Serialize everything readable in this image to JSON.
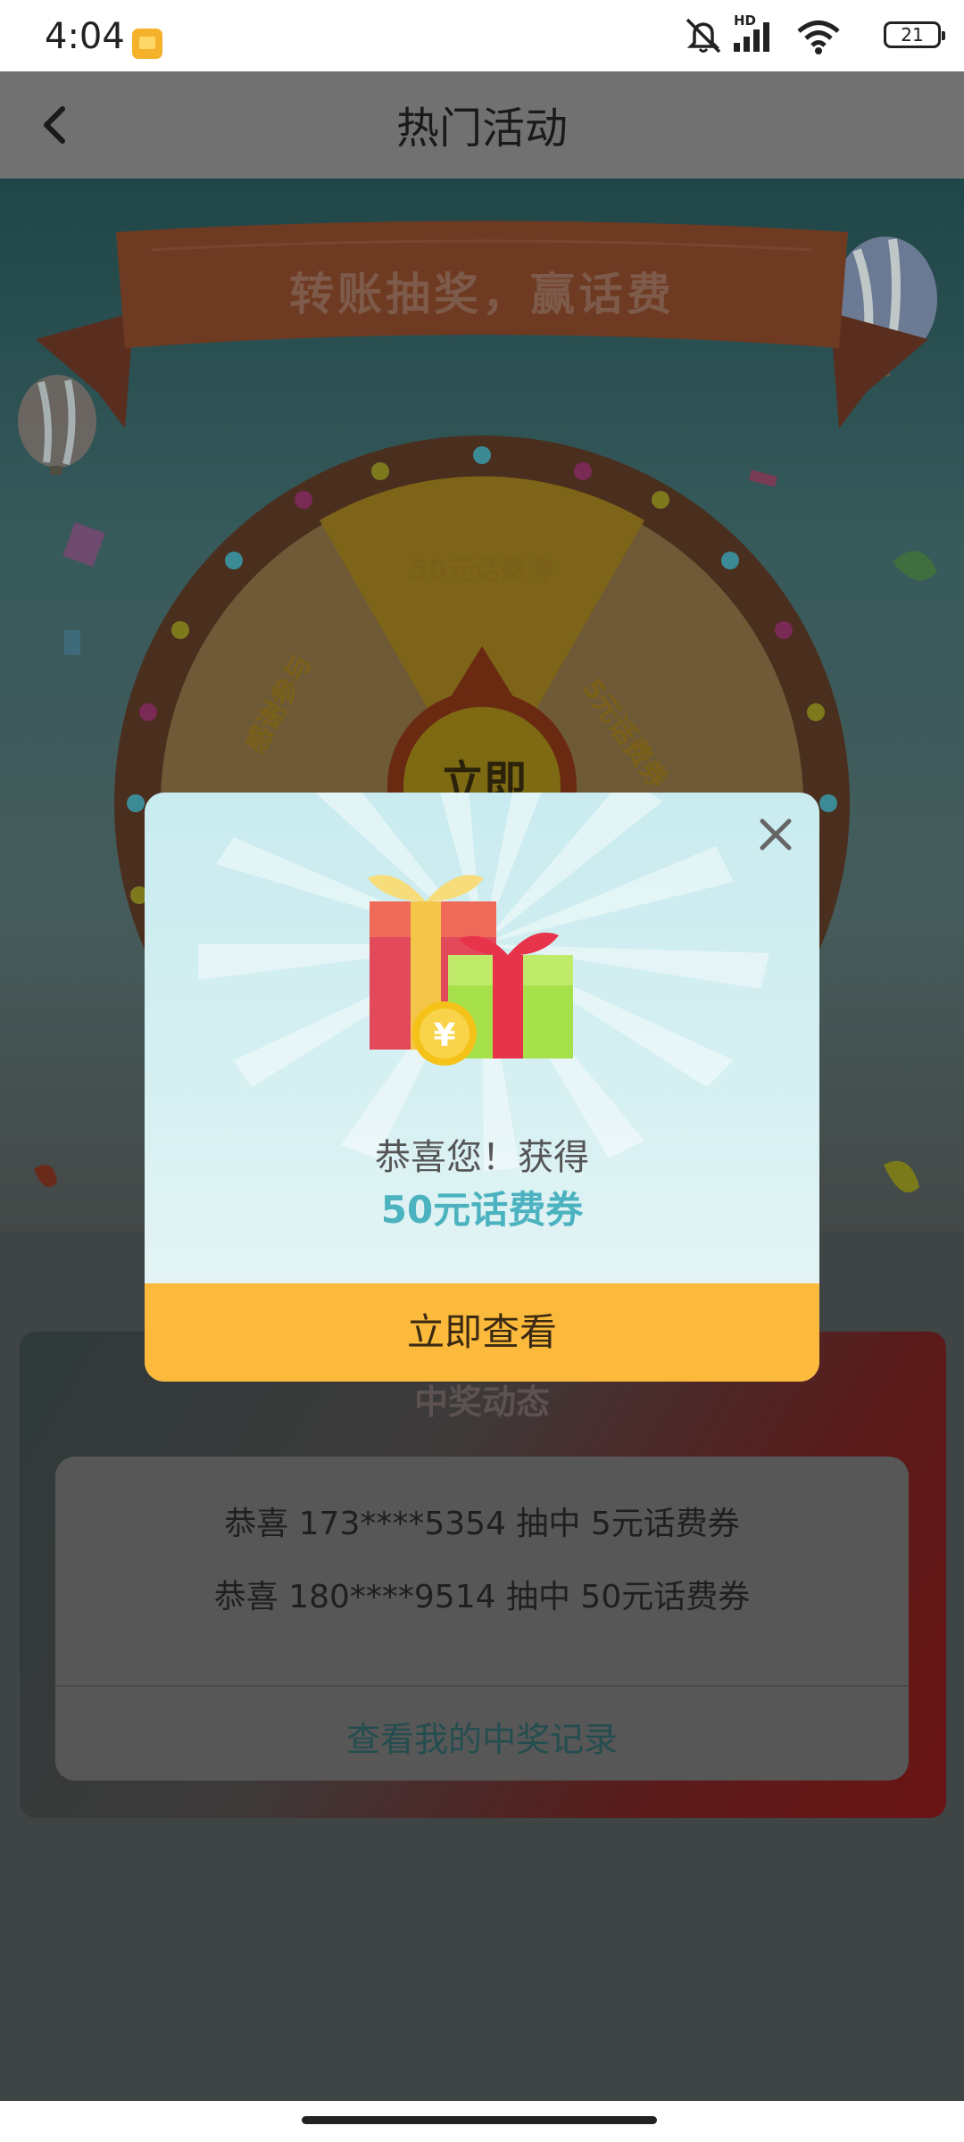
{
  "status_bar": {
    "time": "4:04",
    "battery": "21",
    "hd": "HD",
    "icons": [
      "notification-app-icon",
      "mute-icon",
      "signal-icon",
      "wifi-icon",
      "battery-icon"
    ]
  },
  "header": {
    "title": "热门活动",
    "back_icon": "chevron-left-icon"
  },
  "banner": {
    "text": "转账抽奖，赢话费"
  },
  "wheel": {
    "segments": [
      "50元话费券",
      "5元话费券",
      "感谢参与"
    ],
    "center_button": "立即"
  },
  "winners": {
    "title": "中奖动态",
    "items": [
      "恭喜 173****5354 抽中 5元话费券",
      "恭喜 180****9514 抽中 50元话费券"
    ],
    "link": "查看我的中奖记录"
  },
  "modal": {
    "congrats": "恭喜您！获得",
    "prize": "50元话费券",
    "button": "立即查看",
    "close_icon": "close-icon",
    "coin_symbol": "¥"
  },
  "colors": {
    "accent": "#fbba3c",
    "prize": "#4bb2c0",
    "header": "#717171"
  }
}
